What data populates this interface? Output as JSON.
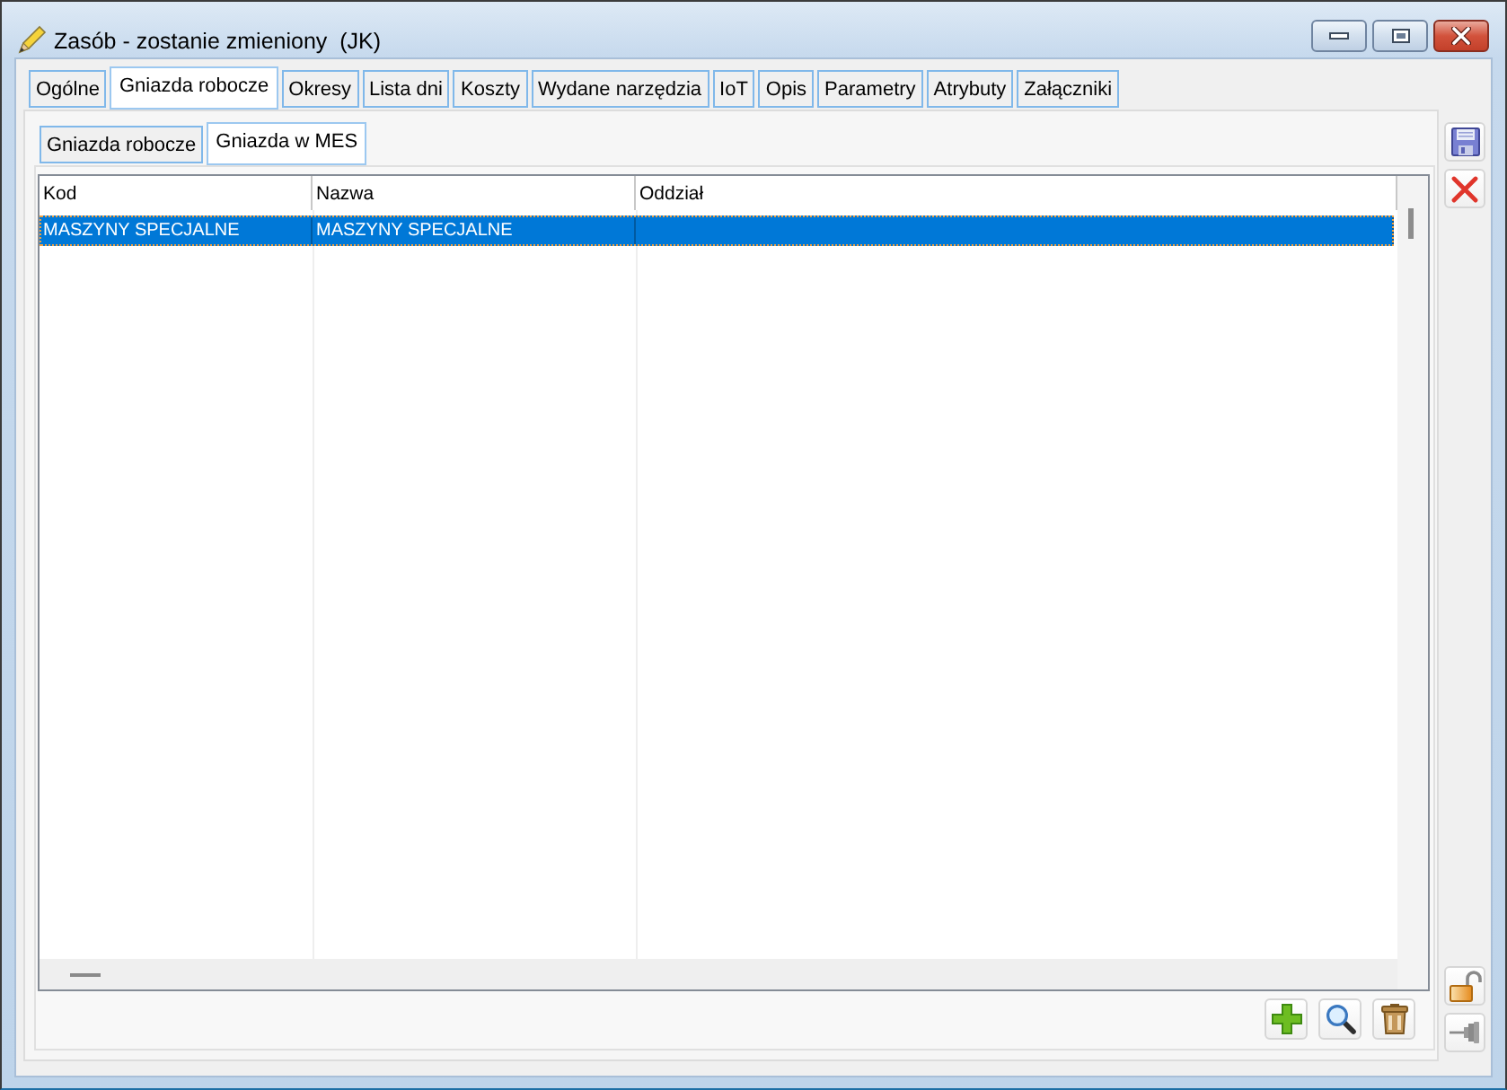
{
  "window": {
    "title": "Zasób - zostanie zmieniony  (JK)"
  },
  "tabs": [
    {
      "label": "Ogólne",
      "selected": false
    },
    {
      "label": "Gniazda robocze",
      "selected": true
    },
    {
      "label": "Okresy",
      "selected": false
    },
    {
      "label": "Lista dni",
      "selected": false
    },
    {
      "label": "Koszty",
      "selected": false
    },
    {
      "label": "Wydane narzędzia",
      "selected": false
    },
    {
      "label": "IoT",
      "selected": false
    },
    {
      "label": "Opis",
      "selected": false
    },
    {
      "label": "Parametry",
      "selected": false
    },
    {
      "label": "Atrybuty",
      "selected": false
    },
    {
      "label": "Załączniki",
      "selected": false
    }
  ],
  "subtabs": [
    {
      "label": "Gniazda robocze",
      "selected": false
    },
    {
      "label": "Gniazda w MES",
      "selected": true
    }
  ],
  "table": {
    "columns": [
      "Kod",
      "Nazwa",
      "Oddział"
    ],
    "rows": [
      {
        "cells": [
          "MASZYNY SPECJALNE",
          "MASZYNY SPECJALNE"
        ],
        "selected": true
      }
    ]
  }
}
